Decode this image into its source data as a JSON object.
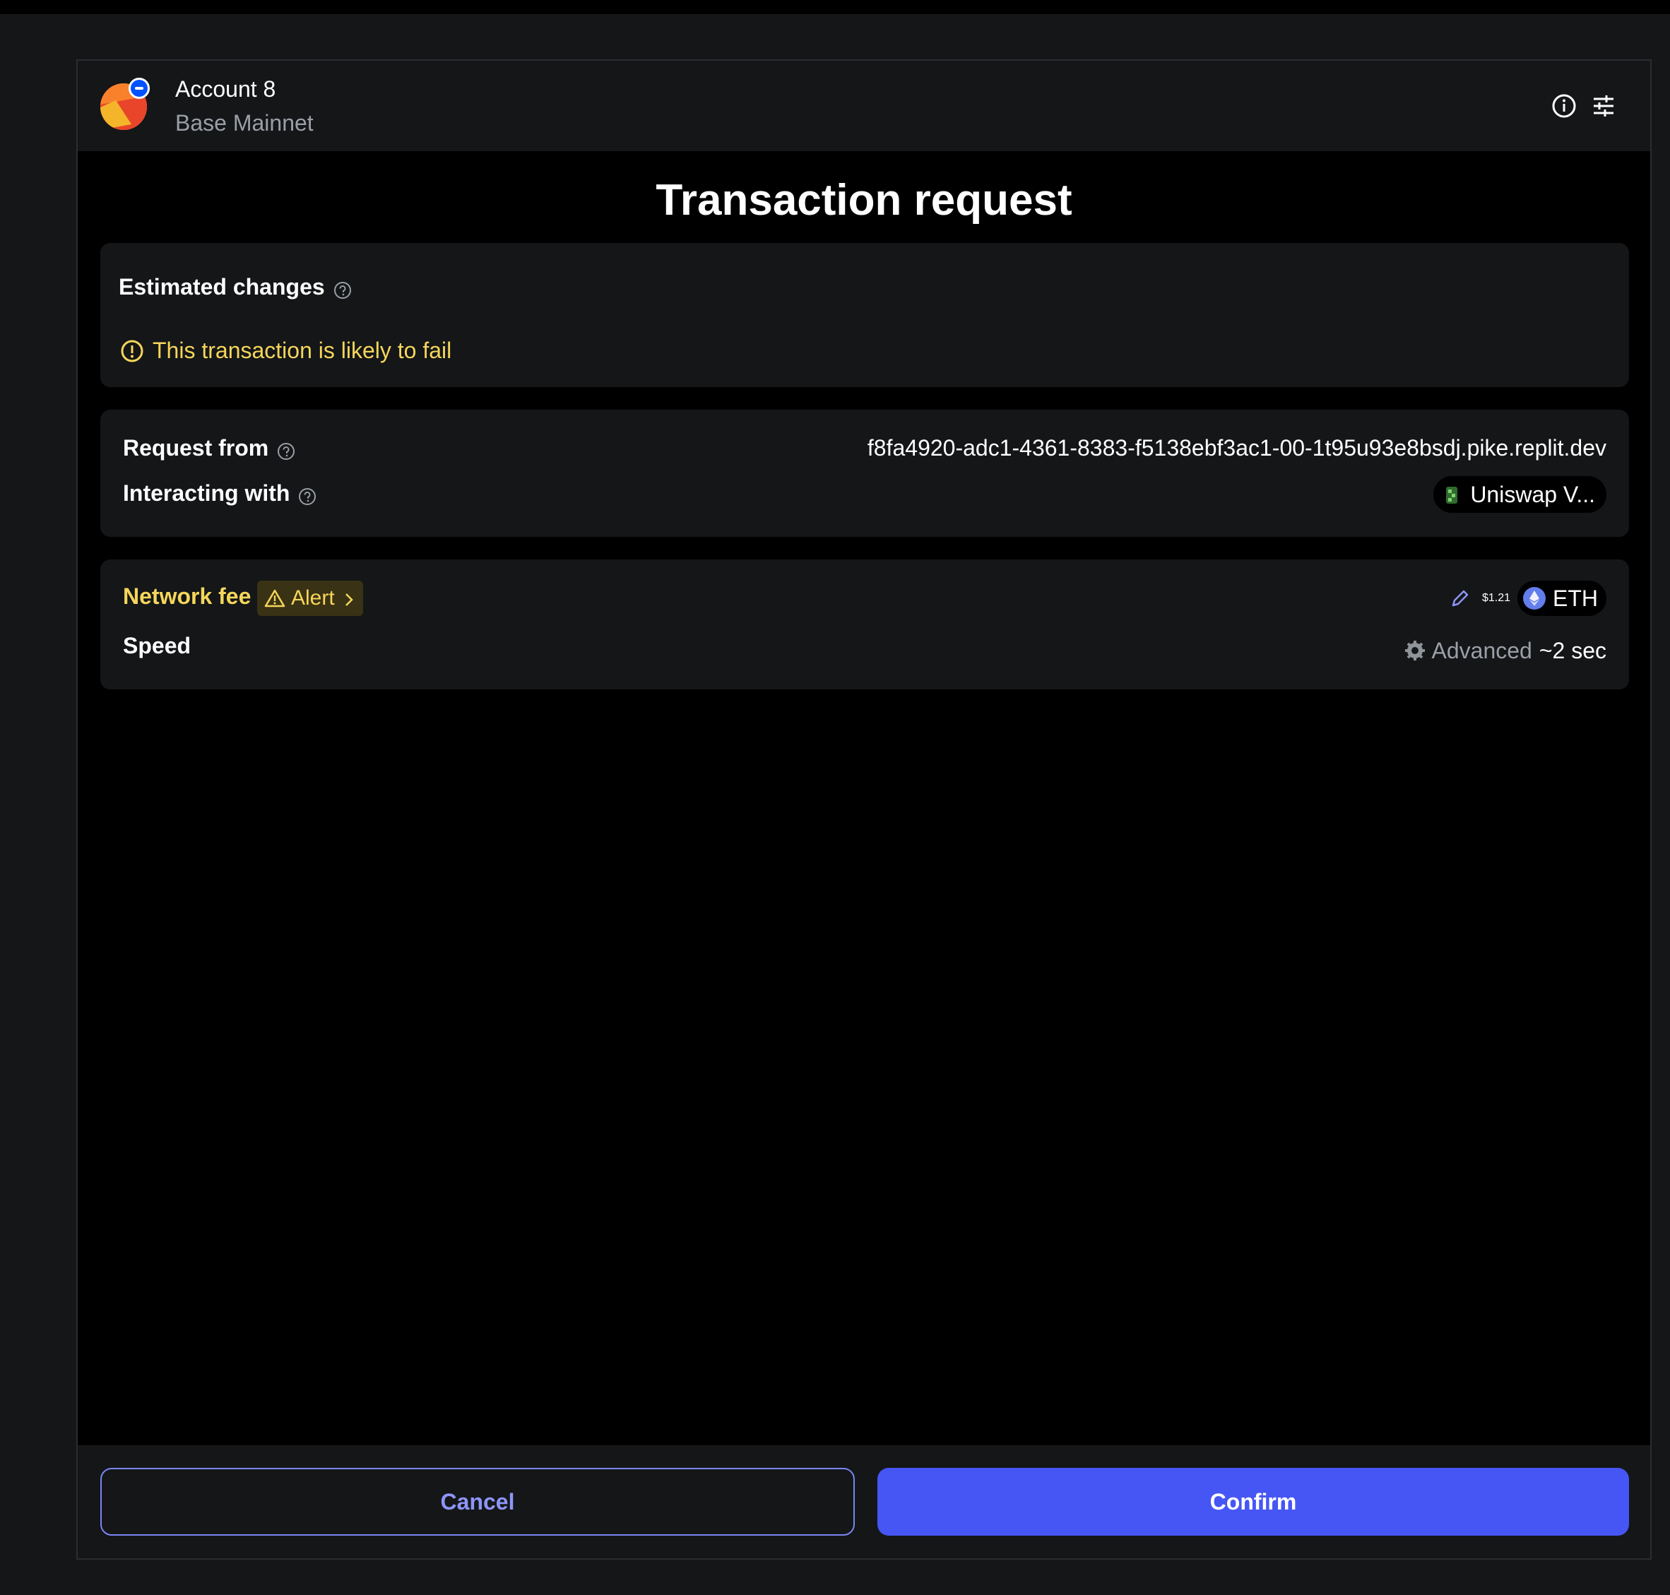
{
  "header": {
    "account_name": "Account 8",
    "network": "Base Mainnet",
    "icons": [
      "info-icon",
      "sliders-icon"
    ]
  },
  "title": "Transaction request",
  "estimated_changes": {
    "label": "Estimated changes",
    "warning": "This transaction is likely to fail"
  },
  "request": {
    "from_label": "Request from",
    "from_value": "f8fa4920-adc1-4361-8383-f5138ebf3ac1-00-1t95u93e8bsdj.pike.replit.dev",
    "interacting_label": "Interacting with",
    "interacting_value": "Uniswap V..."
  },
  "network_fee": {
    "label": "Network fee",
    "alert_label": "Alert",
    "amount": "$1.21",
    "token": "ETH",
    "speed_label": "Speed",
    "speed_mode": "Advanced",
    "speed_time": "~2 sec"
  },
  "footer": {
    "cancel_label": "Cancel",
    "confirm_label": "Confirm"
  },
  "colors": {
    "accent": "#4656f5",
    "warning": "#f5d65a",
    "card_bg": "#141618"
  }
}
